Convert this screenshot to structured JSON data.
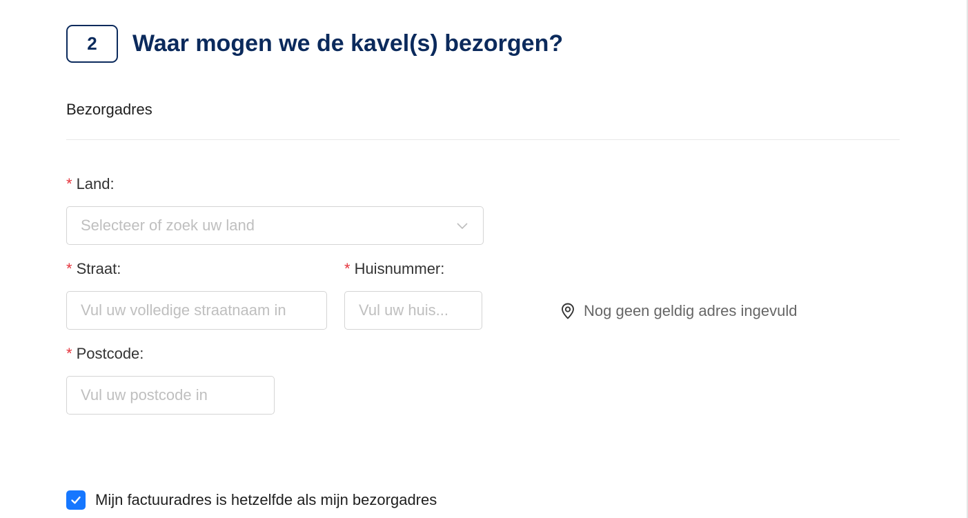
{
  "step": {
    "number": "2",
    "title": "Waar mogen we de kavel(s) bezorgen?"
  },
  "section": {
    "label": "Bezorgadres"
  },
  "required_marker": "*",
  "fields": {
    "country": {
      "label": "Land:",
      "placeholder": "Selecteer of zoek uw land",
      "value": ""
    },
    "street": {
      "label": "Straat:",
      "placeholder": "Vul uw volledige straatnaam in",
      "value": ""
    },
    "house_number": {
      "label": "Huisnummer:",
      "placeholder": "Vul uw huis...",
      "value": ""
    },
    "postcode": {
      "label": "Postcode:",
      "placeholder": "Vul uw postcode in",
      "value": ""
    }
  },
  "address_status": {
    "icon": "location-pin-icon",
    "text": "Nog geen geldig adres ingevuld"
  },
  "billing_same": {
    "label": "Mijn factuuradres is hetzelfde als mijn bezorgadres",
    "checked": true
  },
  "colors": {
    "brand_navy": "#0b2a5c",
    "required": "#e5343d",
    "checkbox_accent": "#1677ff",
    "placeholder": "#bfbfbf",
    "border": "#d4d4d4"
  }
}
